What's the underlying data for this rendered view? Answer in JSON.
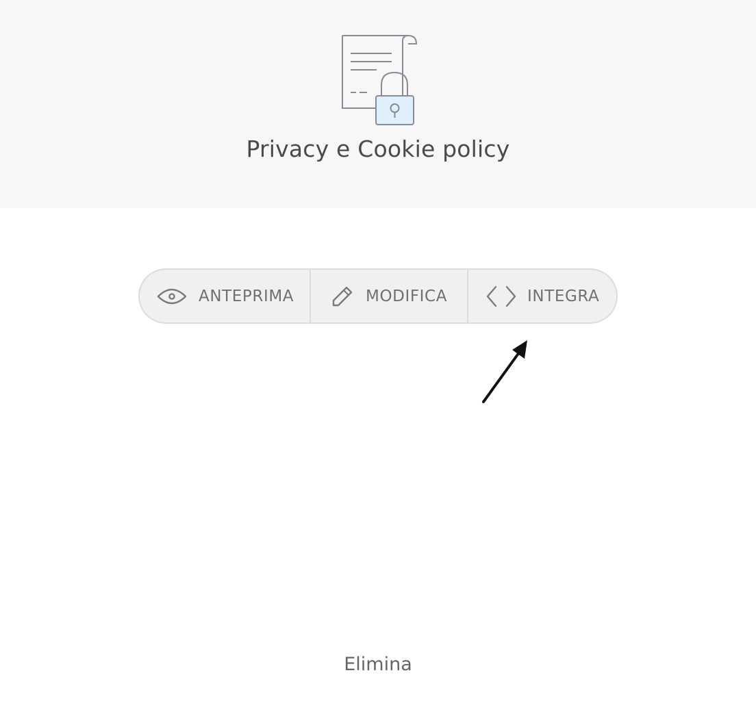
{
  "header": {
    "icon": "document-lock-icon",
    "title": "Privacy e Cookie policy"
  },
  "actions": {
    "preview": {
      "icon": "eye-icon",
      "label": "ANTEPRIMA"
    },
    "edit": {
      "icon": "pencil-icon",
      "label": "MODIFICA"
    },
    "embed": {
      "icon": "code-icon",
      "label": "INTEGRA"
    }
  },
  "annotation": {
    "icon": "arrow-icon"
  },
  "footer": {
    "delete_label": "Elimina"
  },
  "colors": {
    "header_bg": "#f7f7f7",
    "segment_bg": "#f0f0f0",
    "segment_border": "#dcdcdc",
    "text": "#707070",
    "lock_fill": "#dff0fc"
  }
}
